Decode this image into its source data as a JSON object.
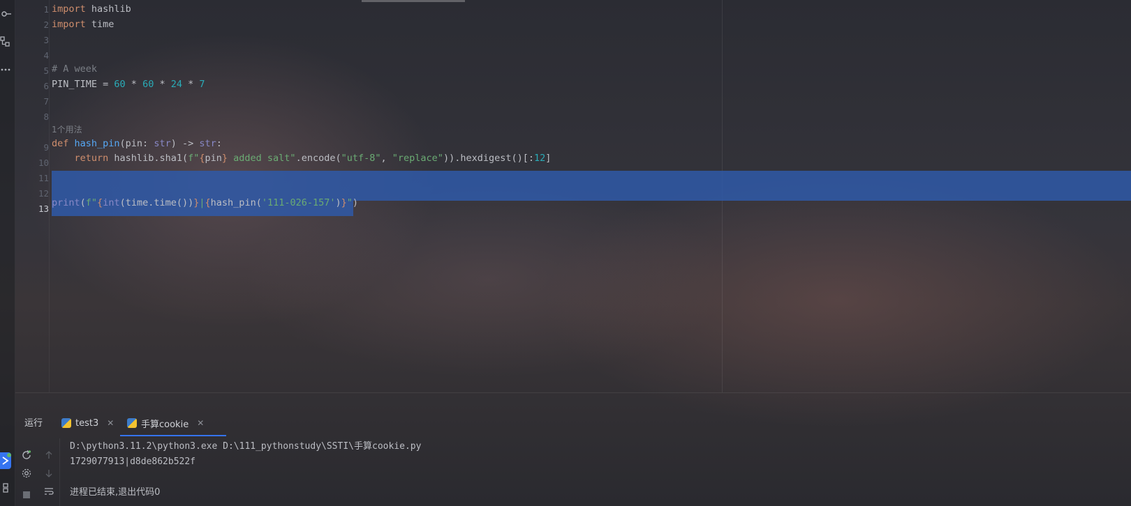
{
  "editor": {
    "usage_hint": "1个用法",
    "line_numbers": [
      "1",
      "2",
      "3",
      "4",
      "5",
      "6",
      "7",
      "8",
      "9",
      "10",
      "11",
      "12",
      "13"
    ],
    "lines": {
      "l1_kw": "import",
      "l1_rest": " hashlib",
      "l2_kw": "import",
      "l2_rest": " time",
      "l5_comment": "# A week",
      "l6_name": "PIN_TIME = ",
      "l6_n1": "60",
      "l6_op1": " * ",
      "l6_n2": "60",
      "l6_op2": " * ",
      "l6_n3": "24",
      "l6_op3": " * ",
      "l6_n4": "7",
      "l9_kw": "def",
      "l9_fn": " hash_pin",
      "l9_p1": "(pin: ",
      "l9_t1": "str",
      "l9_p2": ") -> ",
      "l9_t2": "str",
      "l9_p3": ":",
      "l10_indent": "    ",
      "l10_kw": "return",
      "l10_a": " hashlib.sha1(",
      "l10_f": "f\"",
      "l10_b1": "{",
      "l10_pin": "pin",
      "l10_b2": "}",
      "l10_s": " added salt\"",
      "l10_c": ".encode(",
      "l10_s2": "\"utf-8\"",
      "l10_comma": ", ",
      "l10_s3": "\"replace\"",
      "l10_d": ")).hexdigest()[:",
      "l10_n": "12",
      "l10_e": "]",
      "l13_print": "print",
      "l13_a": "(",
      "l13_f": "f\"",
      "l13_b1": "{",
      "l13_int": "int",
      "l13_b": "(time.time())",
      "l13_b2": "}",
      "l13_pipe": "|",
      "l13_b3": "{",
      "l13_hp": "hash_pin(",
      "l13_s": "'111-026-157'",
      "l13_c": ")",
      "l13_b4": "}",
      "l13_q": "\"",
      "l13_end": ")"
    }
  },
  "run_panel": {
    "label": "运行",
    "tabs": [
      {
        "label": "test3"
      },
      {
        "label": "手算cookie"
      }
    ],
    "console": [
      "D:\\python3.11.2\\python3.exe D:\\111_pythonstudy\\SSTI\\手算cookie.py",
      "1729077913|d8de862b522f",
      "",
      "进程已结束,退出代码0"
    ]
  },
  "colors": {
    "keyword": "#cf8e6d",
    "function": "#56a8f5",
    "number": "#2aacb8",
    "string": "#6aab73",
    "selection": "#2f59a8",
    "accent": "#3574f0"
  },
  "icons": {
    "strip": [
      "commit-icon",
      "structure-icon",
      "more-icon",
      "run-icon",
      "python-packages-icon"
    ],
    "toolbar": [
      "rerun-icon",
      "settings-icon",
      "stop-icon",
      "scroll-up-icon",
      "scroll-down-icon",
      "soft-wrap-icon"
    ]
  }
}
